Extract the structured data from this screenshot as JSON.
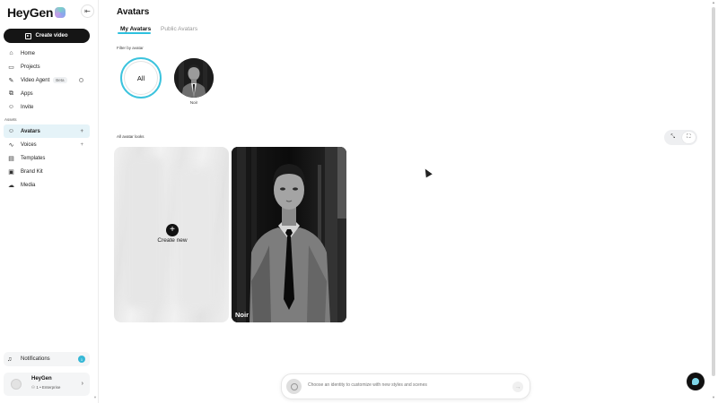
{
  "brand": {
    "name": "HeyGen"
  },
  "sidebar": {
    "collapse_icon": "collapse-left-icon",
    "create_label": "Create video",
    "nav": [
      {
        "label": "Home",
        "icon": "home-icon"
      },
      {
        "label": "Projects",
        "icon": "video-icon"
      },
      {
        "label": "Video Agent",
        "icon": "wand-icon",
        "badge": "Beta"
      },
      {
        "label": "Apps",
        "icon": "apps-icon"
      },
      {
        "label": "Invite",
        "icon": "user-plus-icon"
      }
    ],
    "assets_label": "Assets",
    "assets": [
      {
        "label": "Avatars",
        "icon": "avatar-icon",
        "active": true
      },
      {
        "label": "Voices",
        "icon": "waveform-icon"
      },
      {
        "label": "Templates",
        "icon": "template-icon"
      },
      {
        "label": "Brand Kit",
        "icon": "brand-kit-icon"
      },
      {
        "label": "Media",
        "icon": "cloud-icon"
      }
    ],
    "notifications_label": "Notifications",
    "notifications_count": "1",
    "account": {
      "name": "HeyGen",
      "members": "1",
      "plan": "Enterprise"
    }
  },
  "main": {
    "title": "Avatars",
    "tabs": [
      {
        "label": "My Avatars",
        "active": true
      },
      {
        "label": "Public Avatars",
        "active": false
      }
    ],
    "filter_label": "Filter by avatar",
    "filter_all": "All",
    "filter_avatar_name": "Noir",
    "looks_label": "All avatar looks",
    "create_new_label": "Create new",
    "avatar_card_name": "Noir"
  },
  "prompt": {
    "placeholder": "Choose an identity to customize with new styles and scenes"
  },
  "colors": {
    "accent": "#2dc0de",
    "dark": "#151515"
  }
}
